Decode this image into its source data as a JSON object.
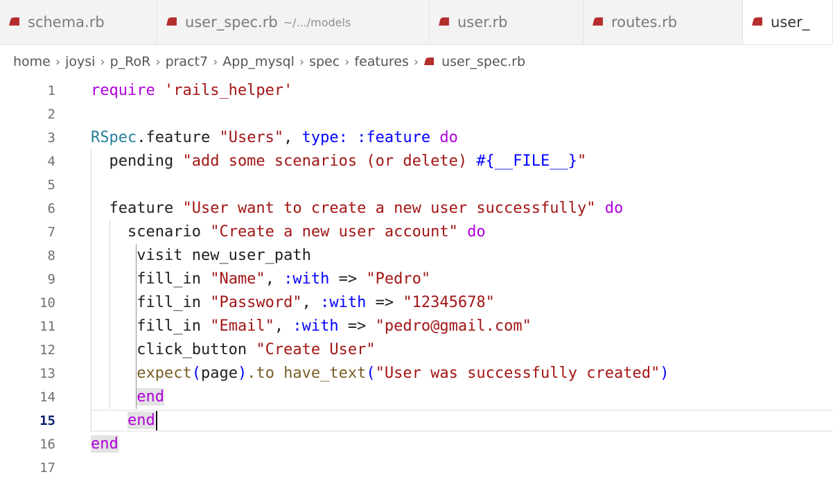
{
  "tabs": [
    {
      "label": "schema.rb",
      "description": "",
      "active": false
    },
    {
      "label": "user_spec.rb",
      "description": "~/.../models",
      "active": false
    },
    {
      "label": "user.rb",
      "description": "",
      "active": false
    },
    {
      "label": "routes.rb",
      "description": "",
      "active": false
    },
    {
      "label": "user_",
      "description": "",
      "active": true
    }
  ],
  "breadcrumb": [
    "home",
    "joysi",
    "p_RoR",
    "pract7",
    "App_mysql",
    "spec",
    "features"
  ],
  "breadcrumb_file": "user_spec.rb",
  "breadcrumb_separator": "›",
  "colors": {
    "ruby_icon": "#b42c2c",
    "keyword": "#af00db",
    "string": "#a31515",
    "symbol": "#0000ff",
    "constant": "#267f99"
  },
  "editor": {
    "active_line": 15,
    "lines": [
      {
        "n": "1",
        "indent": "",
        "tokens": [
          {
            "t": "require ",
            "c": "kw"
          },
          {
            "t": "'rails_helper'",
            "c": "str"
          }
        ]
      },
      {
        "n": "2",
        "indent": "",
        "tokens": []
      },
      {
        "n": "3",
        "indent": "",
        "tokens": [
          {
            "t": "RSpec",
            "c": "const"
          },
          {
            "t": ".feature ",
            "c": ""
          },
          {
            "t": "\"Users\"",
            "c": "str"
          },
          {
            "t": ", ",
            "c": ""
          },
          {
            "t": "type:",
            "c": "sym"
          },
          {
            "t": " ",
            "c": ""
          },
          {
            "t": ":feature",
            "c": "sym"
          },
          {
            "t": " ",
            "c": ""
          },
          {
            "t": "do",
            "c": "kw"
          }
        ]
      },
      {
        "n": "4",
        "indent": "  ",
        "tokens": [
          {
            "t": "pending ",
            "c": ""
          },
          {
            "t": "\"add some scenarios (or delete) ",
            "c": "str"
          },
          {
            "t": "#{__FILE__}",
            "c": "interp"
          },
          {
            "t": "\"",
            "c": "str"
          }
        ]
      },
      {
        "n": "5",
        "indent": "",
        "tokens": []
      },
      {
        "n": "6",
        "indent": "  ",
        "tokens": [
          {
            "t": "feature ",
            "c": ""
          },
          {
            "t": "\"User want to create a new user successfully\"",
            "c": "str"
          },
          {
            "t": " ",
            "c": ""
          },
          {
            "t": "do",
            "c": "kw"
          }
        ]
      },
      {
        "n": "7",
        "indent": "    ",
        "tokens": [
          {
            "t": "scenario ",
            "c": ""
          },
          {
            "t": "\"Create a new user account\"",
            "c": "str"
          },
          {
            "t": " ",
            "c": ""
          },
          {
            "t": "do",
            "c": "kw"
          }
        ]
      },
      {
        "n": "8",
        "indent": "     ",
        "tokens": [
          {
            "t": "visit new_user_path",
            "c": ""
          }
        ]
      },
      {
        "n": "9",
        "indent": "     ",
        "tokens": [
          {
            "t": "fill_in ",
            "c": ""
          },
          {
            "t": "\"Name\"",
            "c": "str"
          },
          {
            "t": ", ",
            "c": ""
          },
          {
            "t": ":with",
            "c": "sym"
          },
          {
            "t": " => ",
            "c": ""
          },
          {
            "t": "\"Pedro\"",
            "c": "str"
          }
        ]
      },
      {
        "n": "10",
        "indent": "     ",
        "tokens": [
          {
            "t": "fill_in ",
            "c": ""
          },
          {
            "t": "\"Password\"",
            "c": "str"
          },
          {
            "t": ", ",
            "c": ""
          },
          {
            "t": ":with",
            "c": "sym"
          },
          {
            "t": " => ",
            "c": ""
          },
          {
            "t": "\"12345678\"",
            "c": "str"
          }
        ]
      },
      {
        "n": "11",
        "indent": "     ",
        "tokens": [
          {
            "t": "fill_in ",
            "c": ""
          },
          {
            "t": "\"Email\"",
            "c": "str"
          },
          {
            "t": ", ",
            "c": ""
          },
          {
            "t": ":with",
            "c": "sym"
          },
          {
            "t": " => ",
            "c": ""
          },
          {
            "t": "\"pedro@gmail.com\"",
            "c": "str"
          }
        ]
      },
      {
        "n": "12",
        "indent": "     ",
        "tokens": [
          {
            "t": "click_button ",
            "c": ""
          },
          {
            "t": "\"Create User\"",
            "c": "str"
          }
        ]
      },
      {
        "n": "13",
        "indent": "     ",
        "tokens": [
          {
            "t": "expect",
            "c": "fn"
          },
          {
            "t": "(",
            "c": "sym"
          },
          {
            "t": "page",
            "c": ""
          },
          {
            "t": ")",
            "c": "sym"
          },
          {
            "t": ".to have_text",
            "c": "fn"
          },
          {
            "t": "(",
            "c": "sym"
          },
          {
            "t": "\"User was successfully created\"",
            "c": "str"
          },
          {
            "t": ")",
            "c": "sym"
          }
        ]
      },
      {
        "n": "14",
        "indent": "     ",
        "tokens": [
          {
            "t": "end",
            "c": "kw hl"
          }
        ]
      },
      {
        "n": "15",
        "indent": "    ",
        "tokens": [
          {
            "t": "end",
            "c": "kw hl"
          }
        ],
        "cursor": true
      },
      {
        "n": "16",
        "indent": "",
        "tokens": [
          {
            "t": "end",
            "c": "kw hl"
          }
        ]
      },
      {
        "n": "17",
        "indent": "",
        "tokens": []
      }
    ]
  }
}
